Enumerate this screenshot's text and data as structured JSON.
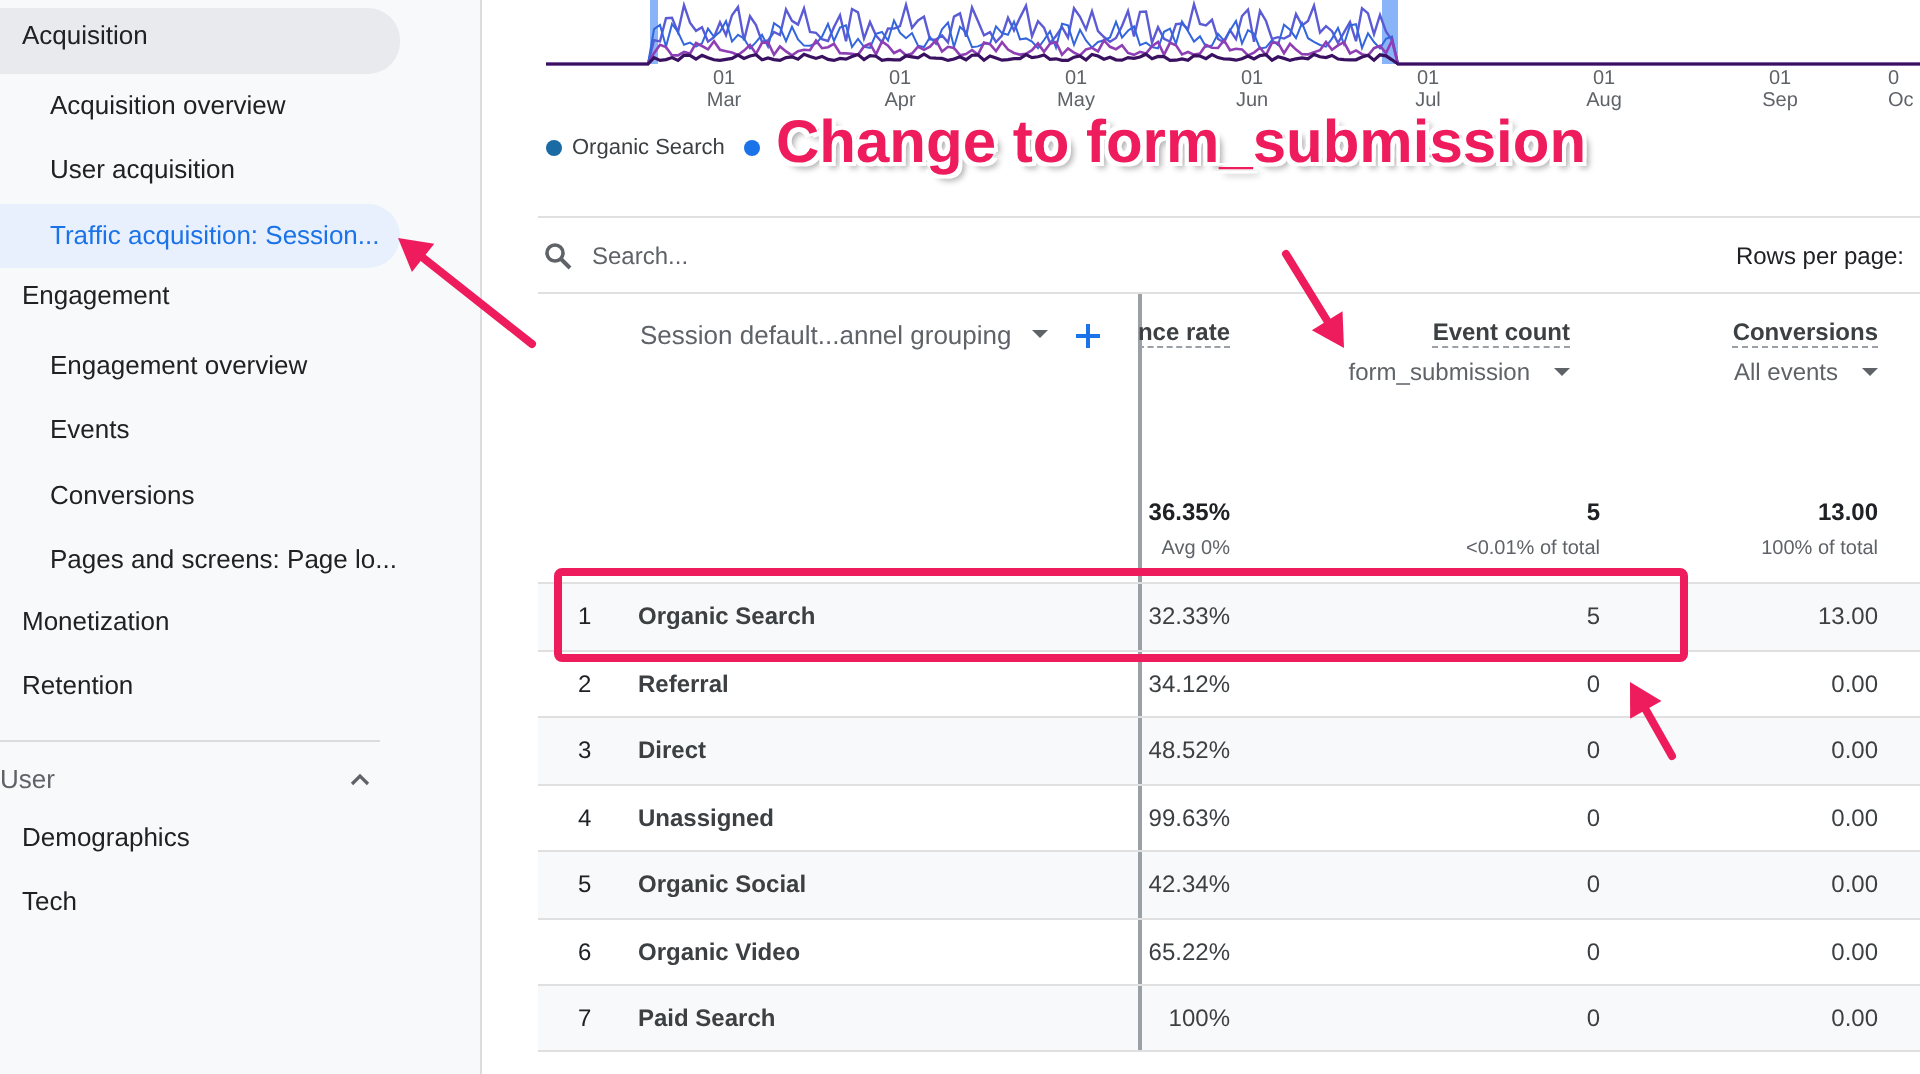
{
  "sidebar": {
    "groups": [
      {
        "items": [
          {
            "label": "Acquisition",
            "active": true,
            "children": [
              {
                "label": "Acquisition overview",
                "selected": false
              },
              {
                "label": "User acquisition",
                "selected": false
              },
              {
                "label": "Traffic acquisition: Session...",
                "selected": true
              }
            ]
          },
          {
            "label": "Engagement",
            "active": false,
            "children": [
              {
                "label": "Engagement overview",
                "selected": false
              },
              {
                "label": "Events",
                "selected": false
              },
              {
                "label": "Conversions",
                "selected": false
              },
              {
                "label": "Pages and screens: Page lo...",
                "selected": false
              }
            ]
          },
          {
            "label": "Monetization",
            "active": false
          },
          {
            "label": "Retention",
            "active": false
          }
        ]
      },
      {
        "title": "User",
        "expanded": true,
        "items": [
          {
            "label": "Demographics",
            "active": false
          },
          {
            "label": "Tech",
            "active": false
          }
        ]
      }
    ]
  },
  "chart": {
    "x_labels": [
      {
        "day": "01",
        "month": "Mar"
      },
      {
        "day": "01",
        "month": "Apr"
      },
      {
        "day": "01",
        "month": "May"
      },
      {
        "day": "01",
        "month": "Jun"
      },
      {
        "day": "01",
        "month": "Jul"
      },
      {
        "day": "01",
        "month": "Aug"
      },
      {
        "day": "01",
        "month": "Sep"
      },
      {
        "day": "0",
        "month": "Oc"
      }
    ],
    "legend": [
      {
        "label": "Organic Search",
        "color": "#1a6aa3"
      },
      {
        "color": "#1a73e8"
      }
    ]
  },
  "search": {
    "placeholder": "Search..."
  },
  "rows_per_page": "Rows per page:",
  "table": {
    "dimension": "Session default...annel grouping",
    "columns": [
      {
        "label": "nce rate"
      },
      {
        "label": "Event count",
        "filter": "form_submission"
      },
      {
        "label": "Conversions",
        "filter": "All events"
      }
    ],
    "totals": [
      {
        "value": "36.35%",
        "note": "Avg 0%"
      },
      {
        "value": "5",
        "note": "<0.01% of total"
      },
      {
        "value": "13.00",
        "note": "100% of total"
      }
    ],
    "rows": [
      {
        "index": "1",
        "name": "Organic Search",
        "cells": [
          "32.33%",
          "5",
          "13.00"
        ]
      },
      {
        "index": "2",
        "name": "Referral",
        "cells": [
          "34.12%",
          "0",
          "0.00"
        ]
      },
      {
        "index": "3",
        "name": "Direct",
        "cells": [
          "48.52%",
          "0",
          "0.00"
        ]
      },
      {
        "index": "4",
        "name": "Unassigned",
        "cells": [
          "99.63%",
          "0",
          "0.00"
        ]
      },
      {
        "index": "5",
        "name": "Organic Social",
        "cells": [
          "42.34%",
          "0",
          "0.00"
        ]
      },
      {
        "index": "6",
        "name": "Organic Video",
        "cells": [
          "65.22%",
          "0",
          "0.00"
        ]
      },
      {
        "index": "7",
        "name": "Paid Search",
        "cells": [
          "100%",
          "0",
          "0.00"
        ]
      }
    ]
  },
  "annotation": {
    "callout": "Change to form_submission"
  }
}
